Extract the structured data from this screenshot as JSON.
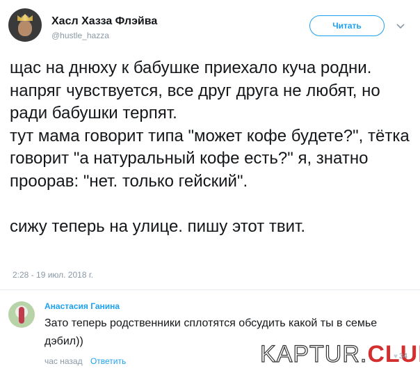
{
  "header": {
    "display_name": "Хасл Хазза Флэйва",
    "handle": "@hustle_hazza",
    "follow_label": "Читать"
  },
  "tweet": {
    "paragraphs": [
      "щас на днюху к бабушке приехало куча родни. напряг чувствуется, все друг друга не любят, но ради бабушки терпят.",
      "тут мама говорит типа \"может кофе будете?\", тётка говорит \"а натуральный кофе есть?\" я, знатно проорав: \"нет. только гейский\".",
      "сижу теперь на улице. пишу этот твит."
    ],
    "timestamp": "2:28 - 19 июл. 2018 г."
  },
  "reply": {
    "author": "Анастасия Ганина",
    "text": "Зато теперь родственники сплотятся обсудить какой ты в семье дэбил))",
    "time": "час назад",
    "reply_label": "Ответить",
    "likes": "34"
  },
  "watermark": {
    "prefix": "KAPTUR.",
    "suffix": "CLUB"
  }
}
